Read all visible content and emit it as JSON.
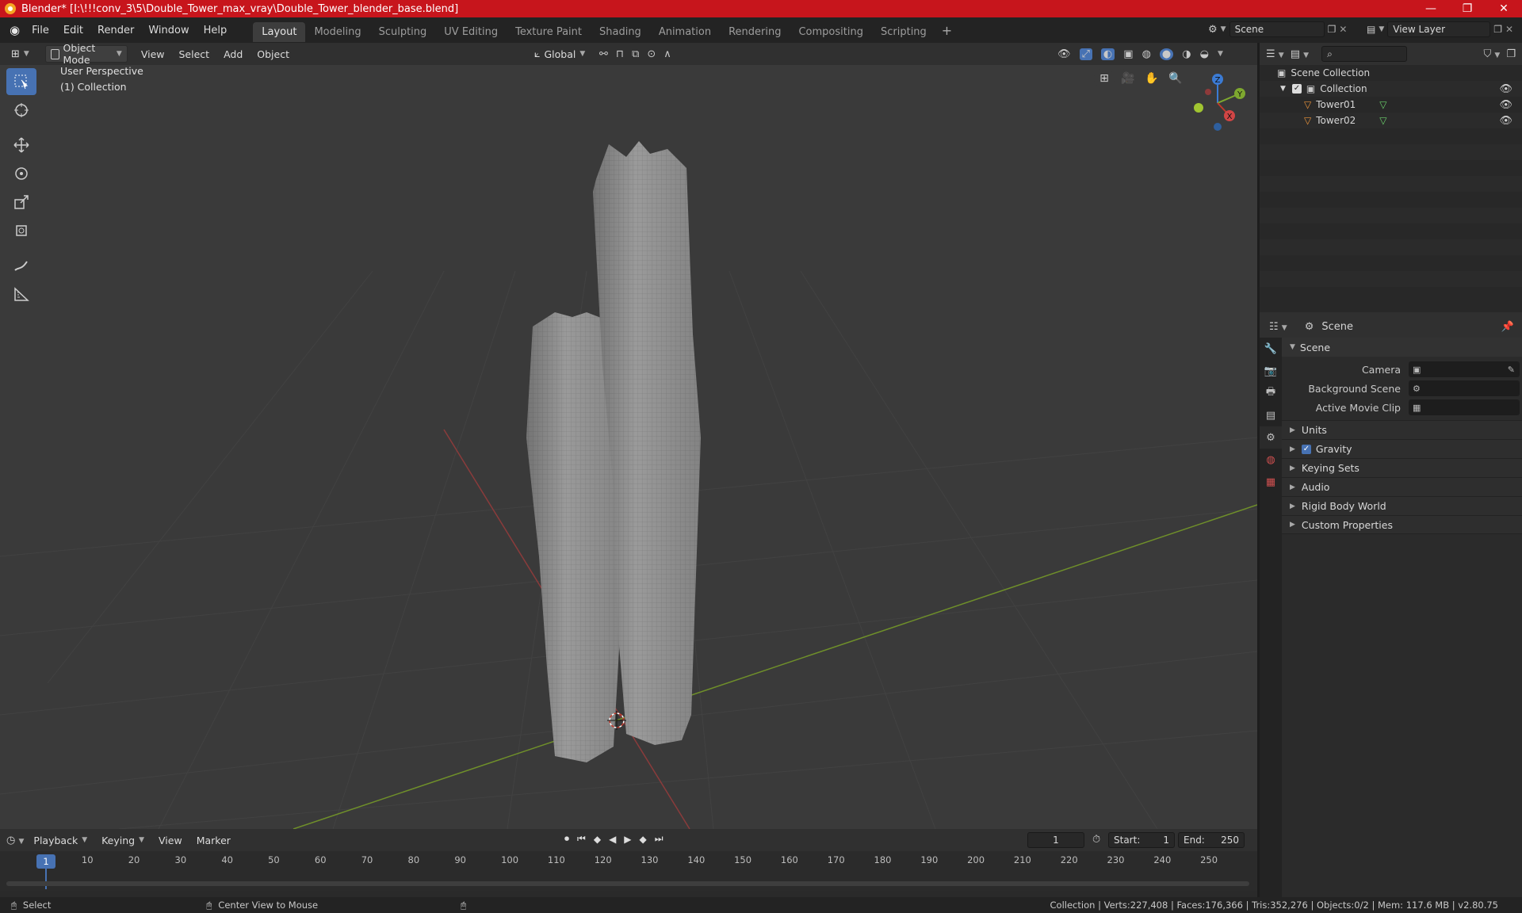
{
  "title": "Blender* [I:\\!!!conv_3\\5\\Double_Tower_max_vray\\Double_Tower_blender_base.blend]",
  "window_controls": [
    "—",
    "❐",
    "✕"
  ],
  "menus": [
    "File",
    "Edit",
    "Render",
    "Window",
    "Help"
  ],
  "workspaces": [
    {
      "label": "Layout",
      "active": true
    },
    {
      "label": "Modeling",
      "active": false
    },
    {
      "label": "Sculpting",
      "active": false
    },
    {
      "label": "UV Editing",
      "active": false
    },
    {
      "label": "Texture Paint",
      "active": false
    },
    {
      "label": "Shading",
      "active": false
    },
    {
      "label": "Animation",
      "active": false
    },
    {
      "label": "Rendering",
      "active": false
    },
    {
      "label": "Compositing",
      "active": false
    },
    {
      "label": "Scripting",
      "active": false
    }
  ],
  "scene_field": "Scene",
  "view_layer_field": "View Layer",
  "viewport_header": {
    "mode": "Object Mode",
    "menus": [
      "View",
      "Select",
      "Add",
      "Object"
    ],
    "transform": "Global"
  },
  "viewport": {
    "perspective": "User Perspective",
    "collection": "(1) Collection",
    "gizmo": {
      "z": "Z",
      "y": "Y",
      "x": "X"
    }
  },
  "outliner": {
    "root": "Scene Collection",
    "collection": "Collection",
    "objects": [
      "Tower01",
      "Tower02"
    ]
  },
  "properties": {
    "header": "Scene",
    "section": "Scene",
    "fields": [
      {
        "label": "Camera"
      },
      {
        "label": "Background Scene"
      },
      {
        "label": "Active Movie Clip"
      }
    ],
    "subpanels": [
      {
        "label": "Units",
        "checkbox": false
      },
      {
        "label": "Gravity",
        "checkbox": true
      },
      {
        "label": "Keying Sets",
        "checkbox": false
      },
      {
        "label": "Audio",
        "checkbox": false
      },
      {
        "label": "Rigid Body World",
        "checkbox": false
      },
      {
        "label": "Custom Properties",
        "checkbox": false
      }
    ]
  },
  "timeline": {
    "menus": [
      "Playback",
      "Keying",
      "View",
      "Marker"
    ],
    "current_frame": "1",
    "start_label": "Start:",
    "start": "1",
    "end_label": "End:",
    "end": "250",
    "ticks": [
      "10",
      "20",
      "30",
      "40",
      "50",
      "60",
      "70",
      "80",
      "90",
      "100",
      "110",
      "120",
      "130",
      "140",
      "150",
      "160",
      "170",
      "180",
      "190",
      "200",
      "210",
      "220",
      "230",
      "240",
      "250"
    ]
  },
  "status": {
    "select": "Select",
    "center": "Center View to Mouse",
    "stats": "Collection | Verts:227,408 | Faces:176,366 | Tris:352,276 | Objects:0/2 | Mem: 117.6 MB | v2.80.75"
  },
  "colors": {
    "accent": "#4772b3",
    "titlebar": "#c7151c",
    "axis_x": "#c0392b",
    "axis_y": "#7ea82f"
  }
}
